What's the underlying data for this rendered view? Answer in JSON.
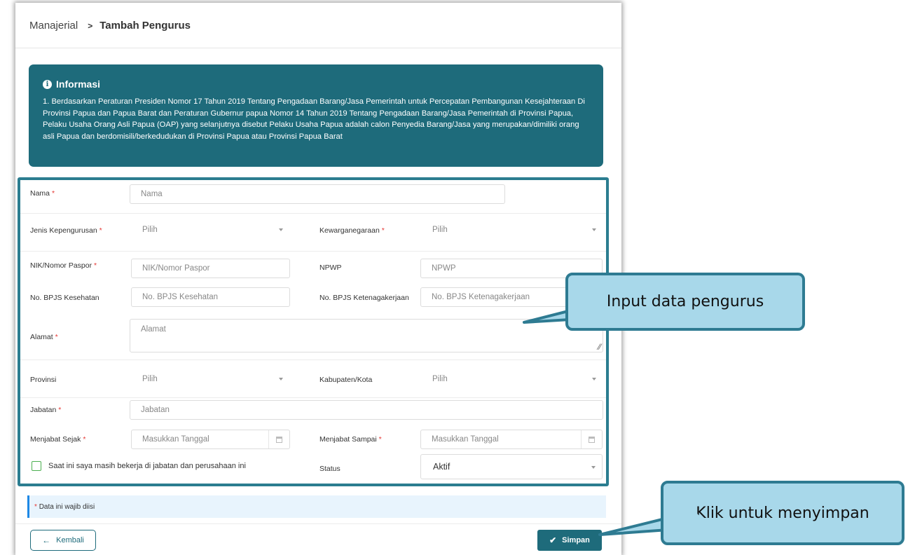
{
  "breadcrumb": {
    "parent": "Manajerial",
    "separator": ">",
    "current": "Tambah Pengurus"
  },
  "info": {
    "title": "Informasi",
    "text": "1. Berdasarkan Peraturan Presiden Nomor 17 Tahun 2019 Tentang Pengadaan Barang/Jasa Pemerintah untuk Percepatan Pembangunan Kesejahteraan Di Provinsi Papua dan Papua Barat dan Peraturan Gubernur papua Nomor 14 Tahun 2019 Tentang Pengadaan Barang/Jasa Pemerintah di Provinsi Papua, Pelaku Usaha Orang Asli Papua (OAP) yang selanjutnya disebut Pelaku Usaha Papua adalah calon Penyedia Barang/Jasa yang merupakan/dimiliki orang asli Papua dan berdomisili/berkedudukan di Provinsi Papua atau Provinsi Papua Barat"
  },
  "form": {
    "nama": {
      "label": "Nama",
      "placeholder": "Nama"
    },
    "jenis": {
      "label": "Jenis Kepengurusan",
      "value": "Pilih"
    },
    "kewarganegaraan": {
      "label": "Kewarganegaraan",
      "value": "Pilih"
    },
    "nik": {
      "label": "NIK/Nomor Paspor",
      "placeholder": "NIK/Nomor Paspor"
    },
    "npwp": {
      "label": "NPWP",
      "placeholder": "NPWP"
    },
    "bpjs_kes": {
      "label": "No. BPJS Kesehatan",
      "placeholder": "No. BPJS Kesehatan"
    },
    "bpjs_tk": {
      "label": "No. BPJS Ketenagakerjaan",
      "placeholder": "No. BPJS Ketenagakerjaan"
    },
    "alamat": {
      "label": "Alamat",
      "placeholder": "Alamat"
    },
    "provinsi": {
      "label": "Provinsi",
      "value": "Pilih"
    },
    "kabupaten": {
      "label": "Kabupaten/Kota",
      "value": "Pilih"
    },
    "jabatan": {
      "label": "Jabatan",
      "placeholder": "Jabatan"
    },
    "sejak": {
      "label": "Menjabat Sejak",
      "placeholder": "Masukkan Tanggal"
    },
    "sampai": {
      "label": "Menjabat Sampai",
      "placeholder": "Masukkan Tanggal"
    },
    "masih_bekerja": {
      "label": "Saat ini saya masih bekerja di jabatan dan perusahaan ini"
    },
    "status": {
      "label": "Status",
      "value": "Aktif"
    },
    "required_mark": "*"
  },
  "note": {
    "mark": "*",
    "text": "Data ini wajib diisi"
  },
  "buttons": {
    "back": "Kembali",
    "save": "Simpan"
  },
  "callouts": {
    "input": "Input data pengurus",
    "save": "Klik untuk menyimpan"
  }
}
